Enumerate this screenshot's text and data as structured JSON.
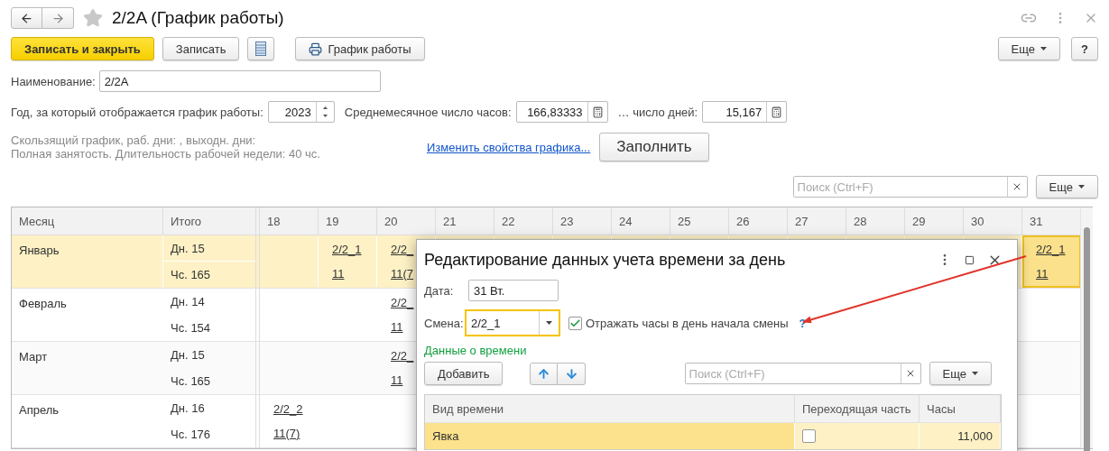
{
  "window": {
    "title": "2/2A (График работы)",
    "favorite": false
  },
  "toolbar": {
    "buttons": [
      {
        "kind": "primary",
        "label": "Записать и закрыть"
      },
      {
        "kind": "plain",
        "label": "Записать"
      },
      {
        "kind": "list"
      },
      {
        "kind": "print",
        "label": "График работы"
      }
    ],
    "more": "Еще",
    "help": "?"
  },
  "fields": {
    "name_label": "Наименование:",
    "name_value": "2/2A",
    "year_label": "Год, за который отображается график работы:",
    "year_value": "2023",
    "avg_hours_label": "Среднемесячное число часов:",
    "avg_hours_value": "166,83333",
    "days_label": "… число дней:",
    "days_value": "15,167"
  },
  "info_lines": [
    "Скользящий график, раб. дни: , выходн. дни:",
    "Полная занятость. Длительность рабочей недели: 40 чс."
  ],
  "change_link": "Изменить свойства графика...",
  "fill_button": "Заполнить",
  "search": {
    "placeholder": "Поиск (Ctrl+F)",
    "more": "Еще"
  },
  "table": {
    "columns": [
      "Месяц",
      "Итого"
    ],
    "days": [
      "18",
      "19",
      "20",
      "21",
      "22",
      "23",
      "24",
      "25",
      "26",
      "27",
      "28",
      "29",
      "30",
      "31"
    ],
    "rows": [
      {
        "month": "Январь",
        "selected": true,
        "days_total": "Дн. 15",
        "hours_total": "Чс. 165",
        "cells": [
          {},
          {
            "shift": "2/2_1",
            "hours": "11",
            "selected": false
          },
          {
            "shift": "2/2_",
            "hours": "11(7",
            "selected": false
          },
          {},
          {},
          {},
          {},
          {},
          {},
          {},
          {},
          {},
          {},
          {
            "shift": "2/2_1",
            "hours": "11",
            "selected": true
          }
        ]
      },
      {
        "month": "Февраль",
        "selected": false,
        "days_total": "Дн. 14",
        "hours_total": "Чс. 154",
        "cells": [
          {},
          {},
          {
            "shift": "2/2_",
            "hours": "11",
            "selected": false
          },
          {},
          {},
          {},
          {},
          {},
          {},
          {},
          {},
          {},
          {},
          {}
        ]
      },
      {
        "month": "Март",
        "selected": false,
        "days_total": "Дн. 15",
        "hours_total": "Чс. 165",
        "cells": [
          {},
          {},
          {
            "shift": "2/2_",
            "hours": "11",
            "selected": false
          },
          {},
          {},
          {},
          {},
          {},
          {},
          {},
          {},
          {},
          {},
          {}
        ]
      },
      {
        "month": "Апрель",
        "selected": false,
        "days_total": "Дн. 16",
        "hours_total": "Чс. 176",
        "cells": [
          {
            "shift": "2/2_2",
            "hours": "11(7)",
            "selected": false
          },
          {},
          {},
          {},
          {},
          {},
          {},
          {},
          {},
          {},
          {},
          {},
          {},
          {}
        ]
      }
    ]
  },
  "dialog": {
    "title": "Редактирование данных учета времени за день",
    "date_label": "Дата:",
    "date_value": "31 Вт.",
    "shift_label": "Смена:",
    "shift_value": "2/2_1",
    "reflect": {
      "label": "Отражать часы в день начала смены",
      "checked": true,
      "help": "?"
    },
    "section": "Данные о времени",
    "add_button": "Добавить",
    "search_placeholder": "Поиск (Ctrl+F)",
    "more": "Еще",
    "columns": [
      "Вид времени",
      "Переходящая часть",
      "Часы"
    ],
    "rows": [
      {
        "type": "Явка",
        "carryover": false,
        "hours": "11,000",
        "selected": true
      }
    ]
  }
}
